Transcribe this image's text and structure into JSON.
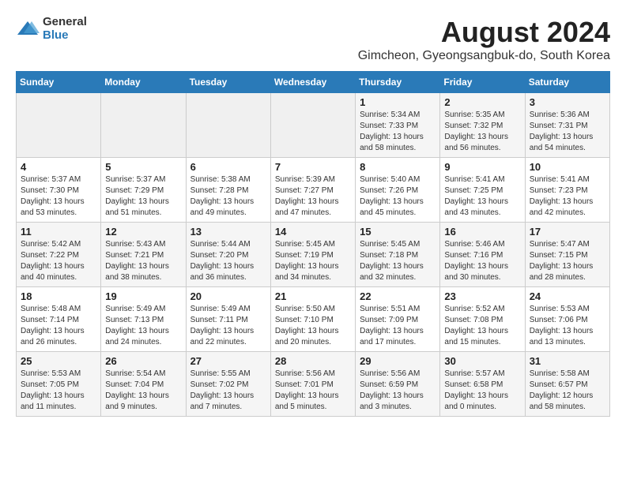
{
  "logo": {
    "general": "General",
    "blue": "Blue"
  },
  "title": "August 2024",
  "subtitle": "Gimcheon, Gyeongsangbuk-do, South Korea",
  "weekdays": [
    "Sunday",
    "Monday",
    "Tuesday",
    "Wednesday",
    "Thursday",
    "Friday",
    "Saturday"
  ],
  "weeks": [
    [
      {
        "day": "",
        "info": ""
      },
      {
        "day": "",
        "info": ""
      },
      {
        "day": "",
        "info": ""
      },
      {
        "day": "",
        "info": ""
      },
      {
        "day": "1",
        "info": "Sunrise: 5:34 AM\nSunset: 7:33 PM\nDaylight: 13 hours\nand 58 minutes."
      },
      {
        "day": "2",
        "info": "Sunrise: 5:35 AM\nSunset: 7:32 PM\nDaylight: 13 hours\nand 56 minutes."
      },
      {
        "day": "3",
        "info": "Sunrise: 5:36 AM\nSunset: 7:31 PM\nDaylight: 13 hours\nand 54 minutes."
      }
    ],
    [
      {
        "day": "4",
        "info": "Sunrise: 5:37 AM\nSunset: 7:30 PM\nDaylight: 13 hours\nand 53 minutes."
      },
      {
        "day": "5",
        "info": "Sunrise: 5:37 AM\nSunset: 7:29 PM\nDaylight: 13 hours\nand 51 minutes."
      },
      {
        "day": "6",
        "info": "Sunrise: 5:38 AM\nSunset: 7:28 PM\nDaylight: 13 hours\nand 49 minutes."
      },
      {
        "day": "7",
        "info": "Sunrise: 5:39 AM\nSunset: 7:27 PM\nDaylight: 13 hours\nand 47 minutes."
      },
      {
        "day": "8",
        "info": "Sunrise: 5:40 AM\nSunset: 7:26 PM\nDaylight: 13 hours\nand 45 minutes."
      },
      {
        "day": "9",
        "info": "Sunrise: 5:41 AM\nSunset: 7:25 PM\nDaylight: 13 hours\nand 43 minutes."
      },
      {
        "day": "10",
        "info": "Sunrise: 5:41 AM\nSunset: 7:23 PM\nDaylight: 13 hours\nand 42 minutes."
      }
    ],
    [
      {
        "day": "11",
        "info": "Sunrise: 5:42 AM\nSunset: 7:22 PM\nDaylight: 13 hours\nand 40 minutes."
      },
      {
        "day": "12",
        "info": "Sunrise: 5:43 AM\nSunset: 7:21 PM\nDaylight: 13 hours\nand 38 minutes."
      },
      {
        "day": "13",
        "info": "Sunrise: 5:44 AM\nSunset: 7:20 PM\nDaylight: 13 hours\nand 36 minutes."
      },
      {
        "day": "14",
        "info": "Sunrise: 5:45 AM\nSunset: 7:19 PM\nDaylight: 13 hours\nand 34 minutes."
      },
      {
        "day": "15",
        "info": "Sunrise: 5:45 AM\nSunset: 7:18 PM\nDaylight: 13 hours\nand 32 minutes."
      },
      {
        "day": "16",
        "info": "Sunrise: 5:46 AM\nSunset: 7:16 PM\nDaylight: 13 hours\nand 30 minutes."
      },
      {
        "day": "17",
        "info": "Sunrise: 5:47 AM\nSunset: 7:15 PM\nDaylight: 13 hours\nand 28 minutes."
      }
    ],
    [
      {
        "day": "18",
        "info": "Sunrise: 5:48 AM\nSunset: 7:14 PM\nDaylight: 13 hours\nand 26 minutes."
      },
      {
        "day": "19",
        "info": "Sunrise: 5:49 AM\nSunset: 7:13 PM\nDaylight: 13 hours\nand 24 minutes."
      },
      {
        "day": "20",
        "info": "Sunrise: 5:49 AM\nSunset: 7:11 PM\nDaylight: 13 hours\nand 22 minutes."
      },
      {
        "day": "21",
        "info": "Sunrise: 5:50 AM\nSunset: 7:10 PM\nDaylight: 13 hours\nand 20 minutes."
      },
      {
        "day": "22",
        "info": "Sunrise: 5:51 AM\nSunset: 7:09 PM\nDaylight: 13 hours\nand 17 minutes."
      },
      {
        "day": "23",
        "info": "Sunrise: 5:52 AM\nSunset: 7:08 PM\nDaylight: 13 hours\nand 15 minutes."
      },
      {
        "day": "24",
        "info": "Sunrise: 5:53 AM\nSunset: 7:06 PM\nDaylight: 13 hours\nand 13 minutes."
      }
    ],
    [
      {
        "day": "25",
        "info": "Sunrise: 5:53 AM\nSunset: 7:05 PM\nDaylight: 13 hours\nand 11 minutes."
      },
      {
        "day": "26",
        "info": "Sunrise: 5:54 AM\nSunset: 7:04 PM\nDaylight: 13 hours\nand 9 minutes."
      },
      {
        "day": "27",
        "info": "Sunrise: 5:55 AM\nSunset: 7:02 PM\nDaylight: 13 hours\nand 7 minutes."
      },
      {
        "day": "28",
        "info": "Sunrise: 5:56 AM\nSunset: 7:01 PM\nDaylight: 13 hours\nand 5 minutes."
      },
      {
        "day": "29",
        "info": "Sunrise: 5:56 AM\nSunset: 6:59 PM\nDaylight: 13 hours\nand 3 minutes."
      },
      {
        "day": "30",
        "info": "Sunrise: 5:57 AM\nSunset: 6:58 PM\nDaylight: 13 hours\nand 0 minutes."
      },
      {
        "day": "31",
        "info": "Sunrise: 5:58 AM\nSunset: 6:57 PM\nDaylight: 12 hours\nand 58 minutes."
      }
    ]
  ]
}
